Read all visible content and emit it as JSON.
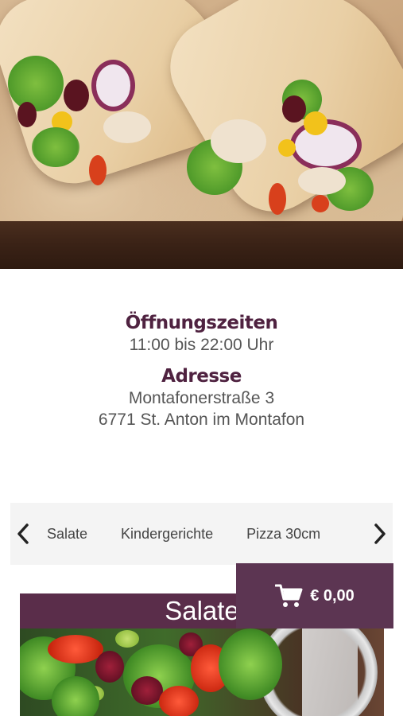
{
  "hours": {
    "heading": "Öffnungszeiten",
    "value": "11:00 bis 22:00 Uhr"
  },
  "address": {
    "heading": "Adresse",
    "street": "Montafonerstraße 3",
    "city": "6771 St. Anton im Montafon"
  },
  "category_nav": {
    "prev_icon": "chevron-left-icon",
    "next_icon": "chevron-right-icon",
    "items": [
      "Salate",
      "Kindergerichte",
      "Pizza 30cm"
    ]
  },
  "section": {
    "title": "Salate"
  },
  "cart": {
    "icon": "cart-icon",
    "total": "€ 0,00"
  },
  "colors": {
    "accent": "#5a2d4a",
    "heading": "#4f2240"
  }
}
